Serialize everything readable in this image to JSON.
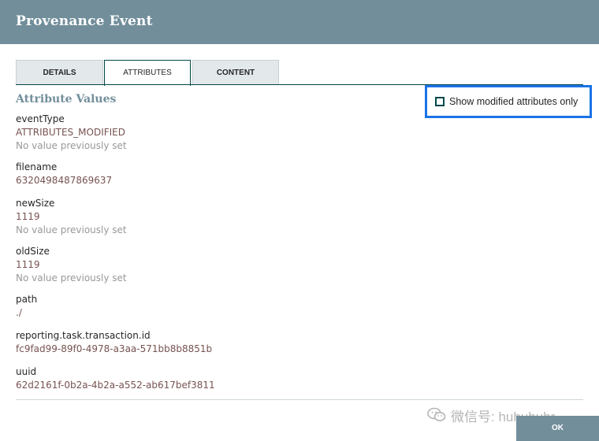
{
  "dialog": {
    "title": "Provenance Event"
  },
  "tabs": [
    {
      "label": "DETAILS"
    },
    {
      "label": "ATTRIBUTES"
    },
    {
      "label": "CONTENT"
    }
  ],
  "section": {
    "title": "Attribute Values"
  },
  "toggle": {
    "label": "Show modified attributes only",
    "checked": false
  },
  "attributes": [
    {
      "name": "eventType",
      "value": "ATTRIBUTES_MODIFIED",
      "previous": "No value previously set"
    },
    {
      "name": "filename",
      "value": "6320498487869637",
      "previous": ""
    },
    {
      "name": "newSize",
      "value": "1119",
      "previous": "No value previously set"
    },
    {
      "name": "oldSize",
      "value": "1119",
      "previous": "No value previously set"
    },
    {
      "name": "path",
      "value": "./",
      "previous": ""
    },
    {
      "name": "reporting.task.transaction.id",
      "value": "fc9fad99-89f0-4978-a3aa-571bb8b8851b",
      "previous": ""
    },
    {
      "name": "uuid",
      "value": "62d2161f-0b2a-4b2a-a552-ab617bef3811",
      "previous": ""
    }
  ],
  "watermark": {
    "text": "微信号: huhuhuhr",
    "icon": "wechat-icon"
  },
  "footer": {
    "ok_label": "OK"
  },
  "colors": {
    "header": "#728e9b",
    "accent": "#004849",
    "value": "#775351",
    "highlight": "#1a73e8"
  }
}
